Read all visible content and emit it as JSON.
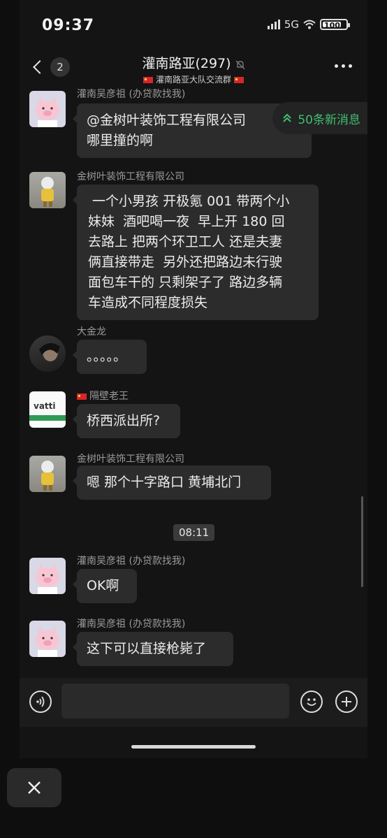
{
  "status_bar": {
    "time": "09:37",
    "network": "5G",
    "battery": "100"
  },
  "header": {
    "back_count": "2",
    "title": "灌南路亚(297)",
    "subtitle": "灌南路亚大队交流群"
  },
  "new_messages": "50条新消息",
  "messages": [
    {
      "sender": "灌南吴彦祖 (办贷款找我)",
      "lines": [
        "@金树叶装饰工程有限公司",
        "哪里撞的啊"
      ]
    },
    {
      "sender": "金树叶装饰工程有限公司",
      "lines": [
        " 一个小男孩 开极氪 001 带两个小",
        "妹妹  酒吧喝一夜  早上开 180 回",
        "去路上 把两个环卫工人 还是夫妻",
        "俩直接带走  另外还把路边未行驶",
        "面包车干的 只剩架子了 路边多辆",
        "车造成不同程度损失"
      ]
    },
    {
      "sender": "大金龙",
      "lines": [
        "。。。。。"
      ]
    },
    {
      "sender": "隔壁老王",
      "lines": [
        "桥西派出所?"
      ],
      "avatar_text": "vatti"
    },
    {
      "sender": "金树叶装饰工程有限公司",
      "lines": [
        "嗯 那个十字路口 黄埔北门"
      ]
    },
    {
      "sender": "灌南吴彦祖 (办贷款找我)",
      "lines": [
        "OK啊"
      ]
    },
    {
      "sender": "灌南吴彦祖 (办贷款找我)",
      "lines": [
        "这下可以直接枪毙了"
      ]
    }
  ],
  "timestamp": "08:11",
  "colors": {
    "accent_green": "#3fbf6f",
    "bubble": "#2c2c2c",
    "background": "#141414"
  }
}
